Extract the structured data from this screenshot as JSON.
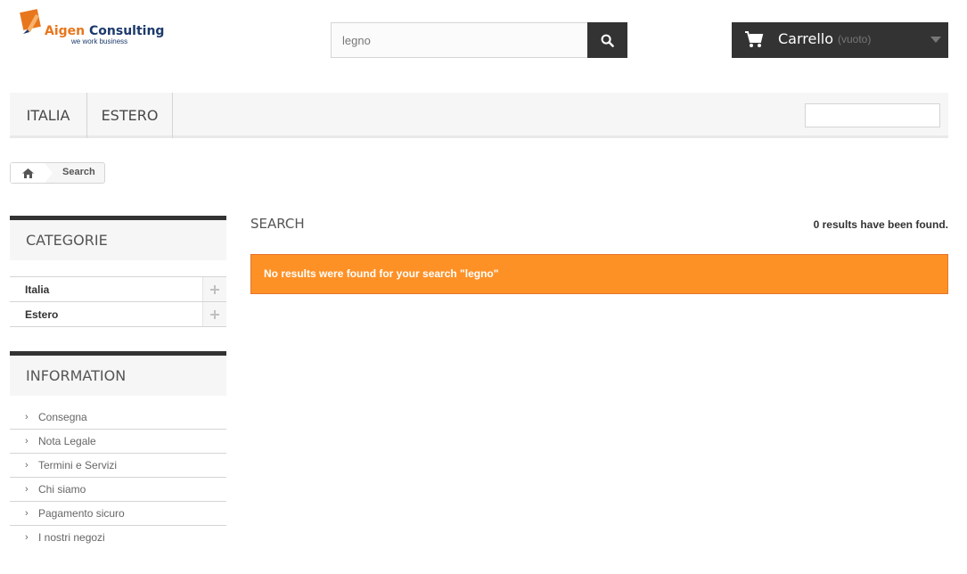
{
  "logo": {
    "name_first": "Aigen",
    "name_second": "Consulting",
    "tagline": "we work business"
  },
  "search": {
    "value": "legno",
    "icon": "search-icon"
  },
  "cart": {
    "label": "Carrello",
    "status": "(vuoto)",
    "icon": "cart-icon"
  },
  "nav": {
    "items": [
      {
        "label": "ITALIA"
      },
      {
        "label": "ESTERO"
      }
    ],
    "search_value": ""
  },
  "breadcrumb": {
    "current": "Search",
    "home_icon": "home-icon"
  },
  "sidebar": {
    "categories": {
      "title": "CATEGORIE",
      "items": [
        {
          "label": "Italia"
        },
        {
          "label": "Estero"
        }
      ]
    },
    "information": {
      "title": "INFORMATION",
      "items": [
        {
          "label": "Consegna"
        },
        {
          "label": "Nota Legale"
        },
        {
          "label": "Termini e Servizi"
        },
        {
          "label": "Chi siamo"
        },
        {
          "label": "Pagamento sicuro"
        },
        {
          "label": "I nostri negozi"
        }
      ]
    }
  },
  "main": {
    "title": "SEARCH",
    "result_count": "0 results have been found.",
    "alert": "No results were found for your search \"legno\""
  },
  "colors": {
    "accent": "#fe9126",
    "dark": "#333333",
    "logo_orange": "#e8761c",
    "logo_blue": "#1c3a6b"
  }
}
